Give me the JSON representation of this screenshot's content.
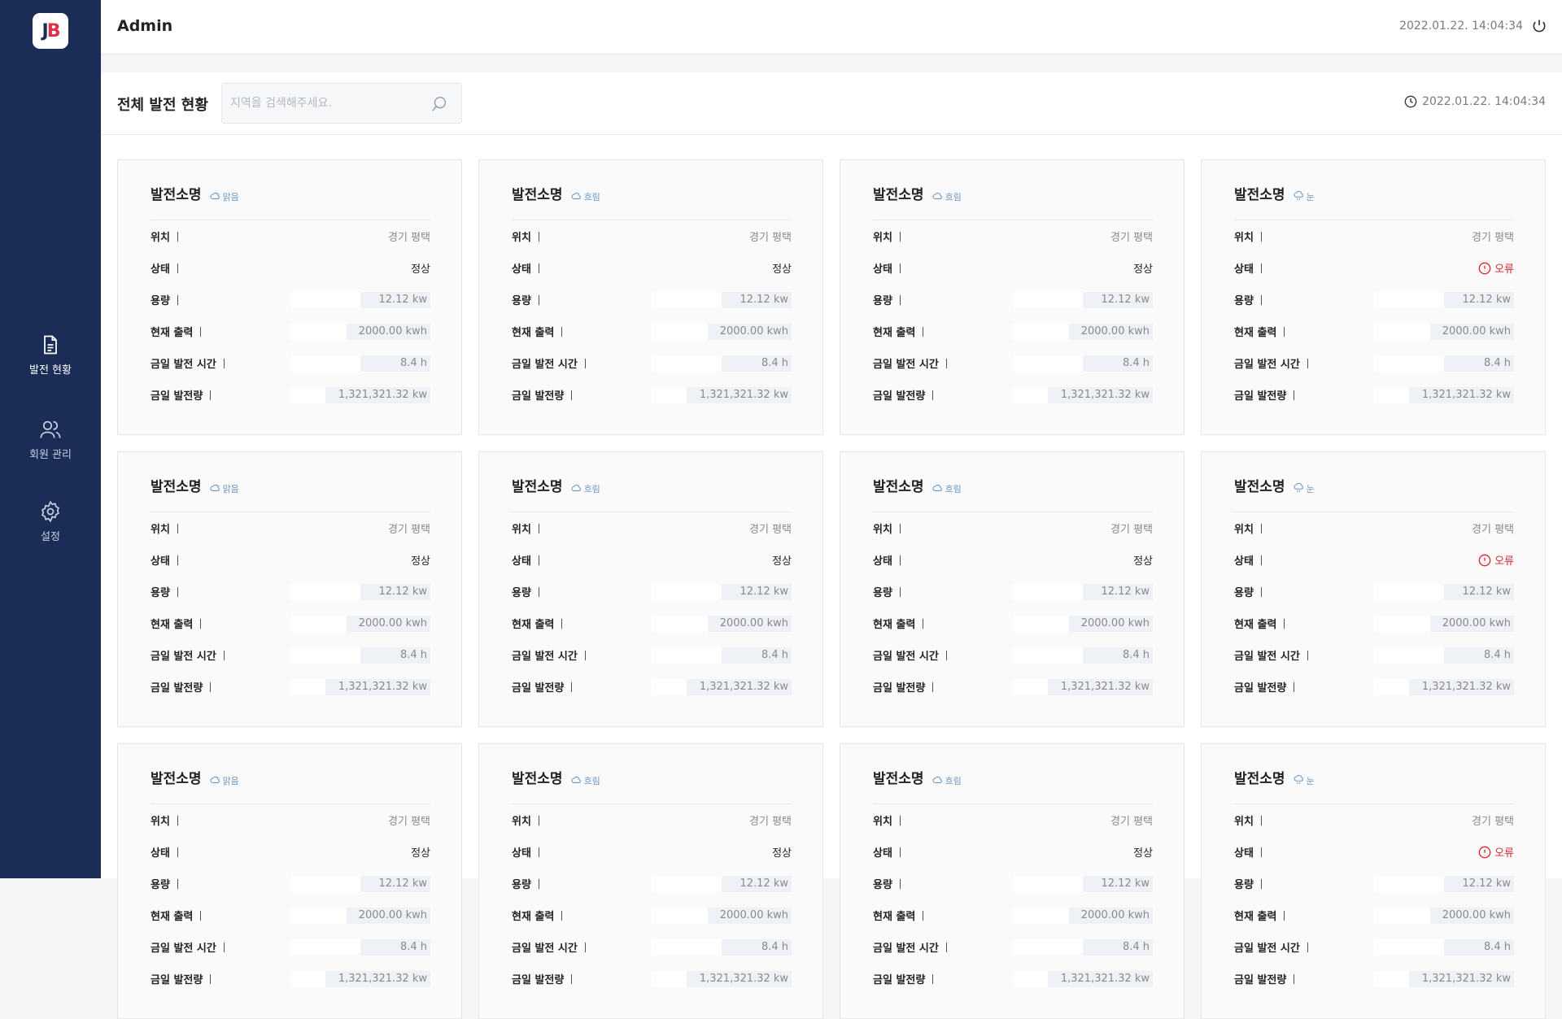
{
  "logo": {
    "text_j": "J",
    "text_b": "B"
  },
  "sidebar": {
    "items": [
      {
        "label": "발전 현황",
        "icon": "document-icon",
        "active": true
      },
      {
        "label": "회원 관리",
        "icon": "users-icon",
        "active": false
      },
      {
        "label": "설정",
        "icon": "gear-icon",
        "active": false
      }
    ]
  },
  "topbar": {
    "title": "Admin",
    "time": "2022.01.22. 14:04:34",
    "power_icon": "power-icon"
  },
  "overview": {
    "title": "전체 발전 현황",
    "search_placeholder": "지역을 검색해주세요.",
    "time": "2022.01.22. 14:04:34"
  },
  "labels": {
    "location": "위치",
    "status": "상태",
    "capacity": "용량",
    "current_output": "현재 출력",
    "today_hours": "금일 발전 시간",
    "today_generation": "금일 발전량"
  },
  "colors": {
    "sidebar": "#1b2c57",
    "error": "#d8252f",
    "weather": "#6b95c4"
  },
  "cards": [
    {
      "name": "발전소명",
      "weather": "맑음",
      "weather_icon": "sun-icon",
      "location": "경기 평택",
      "status": "정상",
      "status_type": "ok",
      "capacity": "12.12 kw",
      "capacity_fill": 0.5,
      "output": "2000.00 kwh",
      "output_fill": 0.6,
      "hours": "8.4 h",
      "hours_fill": 0.5,
      "generation": "1,321,321.32 kw",
      "generation_fill": 0.75
    },
    {
      "name": "발전소명",
      "weather": "흐림",
      "weather_icon": "cloud-icon",
      "location": "경기 평택",
      "status": "정상",
      "status_type": "ok",
      "capacity": "12.12 kw",
      "capacity_fill": 0.5,
      "output": "2000.00 kwh",
      "output_fill": 0.6,
      "hours": "8.4 h",
      "hours_fill": 0.5,
      "generation": "1,321,321.32 kw",
      "generation_fill": 0.75
    },
    {
      "name": "발전소명",
      "weather": "흐림",
      "weather_icon": "cloud-icon",
      "location": "경기 평택",
      "status": "정상",
      "status_type": "ok",
      "capacity": "12.12 kw",
      "capacity_fill": 0.5,
      "output": "2000.00 kwh",
      "output_fill": 0.6,
      "hours": "8.4 h",
      "hours_fill": 0.5,
      "generation": "1,321,321.32 kw",
      "generation_fill": 0.75
    },
    {
      "name": "발전소명",
      "weather": "눈",
      "weather_icon": "snow-icon",
      "location": "경기 평택",
      "status": "오류",
      "status_type": "error",
      "capacity": "12.12 kw",
      "capacity_fill": 0.5,
      "output": "2000.00 kwh",
      "output_fill": 0.6,
      "hours": "8.4 h",
      "hours_fill": 0.5,
      "generation": "1,321,321.32 kw",
      "generation_fill": 0.75
    },
    {
      "name": "발전소명",
      "weather": "맑음",
      "weather_icon": "sun-icon",
      "location": "경기 평택",
      "status": "정상",
      "status_type": "ok",
      "capacity": "12.12 kw",
      "capacity_fill": 0.5,
      "output": "2000.00 kwh",
      "output_fill": 0.6,
      "hours": "8.4 h",
      "hours_fill": 0.5,
      "generation": "1,321,321.32 kw",
      "generation_fill": 0.75
    },
    {
      "name": "발전소명",
      "weather": "흐림",
      "weather_icon": "cloud-icon",
      "location": "경기 평택",
      "status": "정상",
      "status_type": "ok",
      "capacity": "12.12 kw",
      "capacity_fill": 0.5,
      "output": "2000.00 kwh",
      "output_fill": 0.6,
      "hours": "8.4 h",
      "hours_fill": 0.5,
      "generation": "1,321,321.32 kw",
      "generation_fill": 0.75
    },
    {
      "name": "발전소명",
      "weather": "흐림",
      "weather_icon": "cloud-icon",
      "location": "경기 평택",
      "status": "정상",
      "status_type": "ok",
      "capacity": "12.12 kw",
      "capacity_fill": 0.5,
      "output": "2000.00 kwh",
      "output_fill": 0.6,
      "hours": "8.4 h",
      "hours_fill": 0.5,
      "generation": "1,321,321.32 kw",
      "generation_fill": 0.75
    },
    {
      "name": "발전소명",
      "weather": "눈",
      "weather_icon": "snow-icon",
      "location": "경기 평택",
      "status": "오류",
      "status_type": "error",
      "capacity": "12.12 kw",
      "capacity_fill": 0.5,
      "output": "2000.00 kwh",
      "output_fill": 0.6,
      "hours": "8.4 h",
      "hours_fill": 0.5,
      "generation": "1,321,321.32 kw",
      "generation_fill": 0.75
    },
    {
      "name": "발전소명",
      "weather": "맑음",
      "weather_icon": "sun-icon",
      "location": "경기 평택",
      "status": "정상",
      "status_type": "ok",
      "capacity": "12.12 kw",
      "capacity_fill": 0.5,
      "output": "2000.00 kwh",
      "output_fill": 0.6,
      "hours": "8.4 h",
      "hours_fill": 0.5,
      "generation": "1,321,321.32 kw",
      "generation_fill": 0.75
    },
    {
      "name": "발전소명",
      "weather": "흐림",
      "weather_icon": "cloud-icon",
      "location": "경기 평택",
      "status": "정상",
      "status_type": "ok",
      "capacity": "12.12 kw",
      "capacity_fill": 0.5,
      "output": "2000.00 kwh",
      "output_fill": 0.6,
      "hours": "8.4 h",
      "hours_fill": 0.5,
      "generation": "1,321,321.32 kw",
      "generation_fill": 0.75
    },
    {
      "name": "발전소명",
      "weather": "흐림",
      "weather_icon": "cloud-icon",
      "location": "경기 평택",
      "status": "정상",
      "status_type": "ok",
      "capacity": "12.12 kw",
      "capacity_fill": 0.5,
      "output": "2000.00 kwh",
      "output_fill": 0.6,
      "hours": "8.4 h",
      "hours_fill": 0.5,
      "generation": "1,321,321.32 kw",
      "generation_fill": 0.75
    },
    {
      "name": "발전소명",
      "weather": "눈",
      "weather_icon": "snow-icon",
      "location": "경기 평택",
      "status": "오류",
      "status_type": "error",
      "capacity": "12.12 kw",
      "capacity_fill": 0.5,
      "output": "2000.00 kwh",
      "output_fill": 0.6,
      "hours": "8.4 h",
      "hours_fill": 0.5,
      "generation": "1,321,321.32 kw",
      "generation_fill": 0.75
    }
  ]
}
